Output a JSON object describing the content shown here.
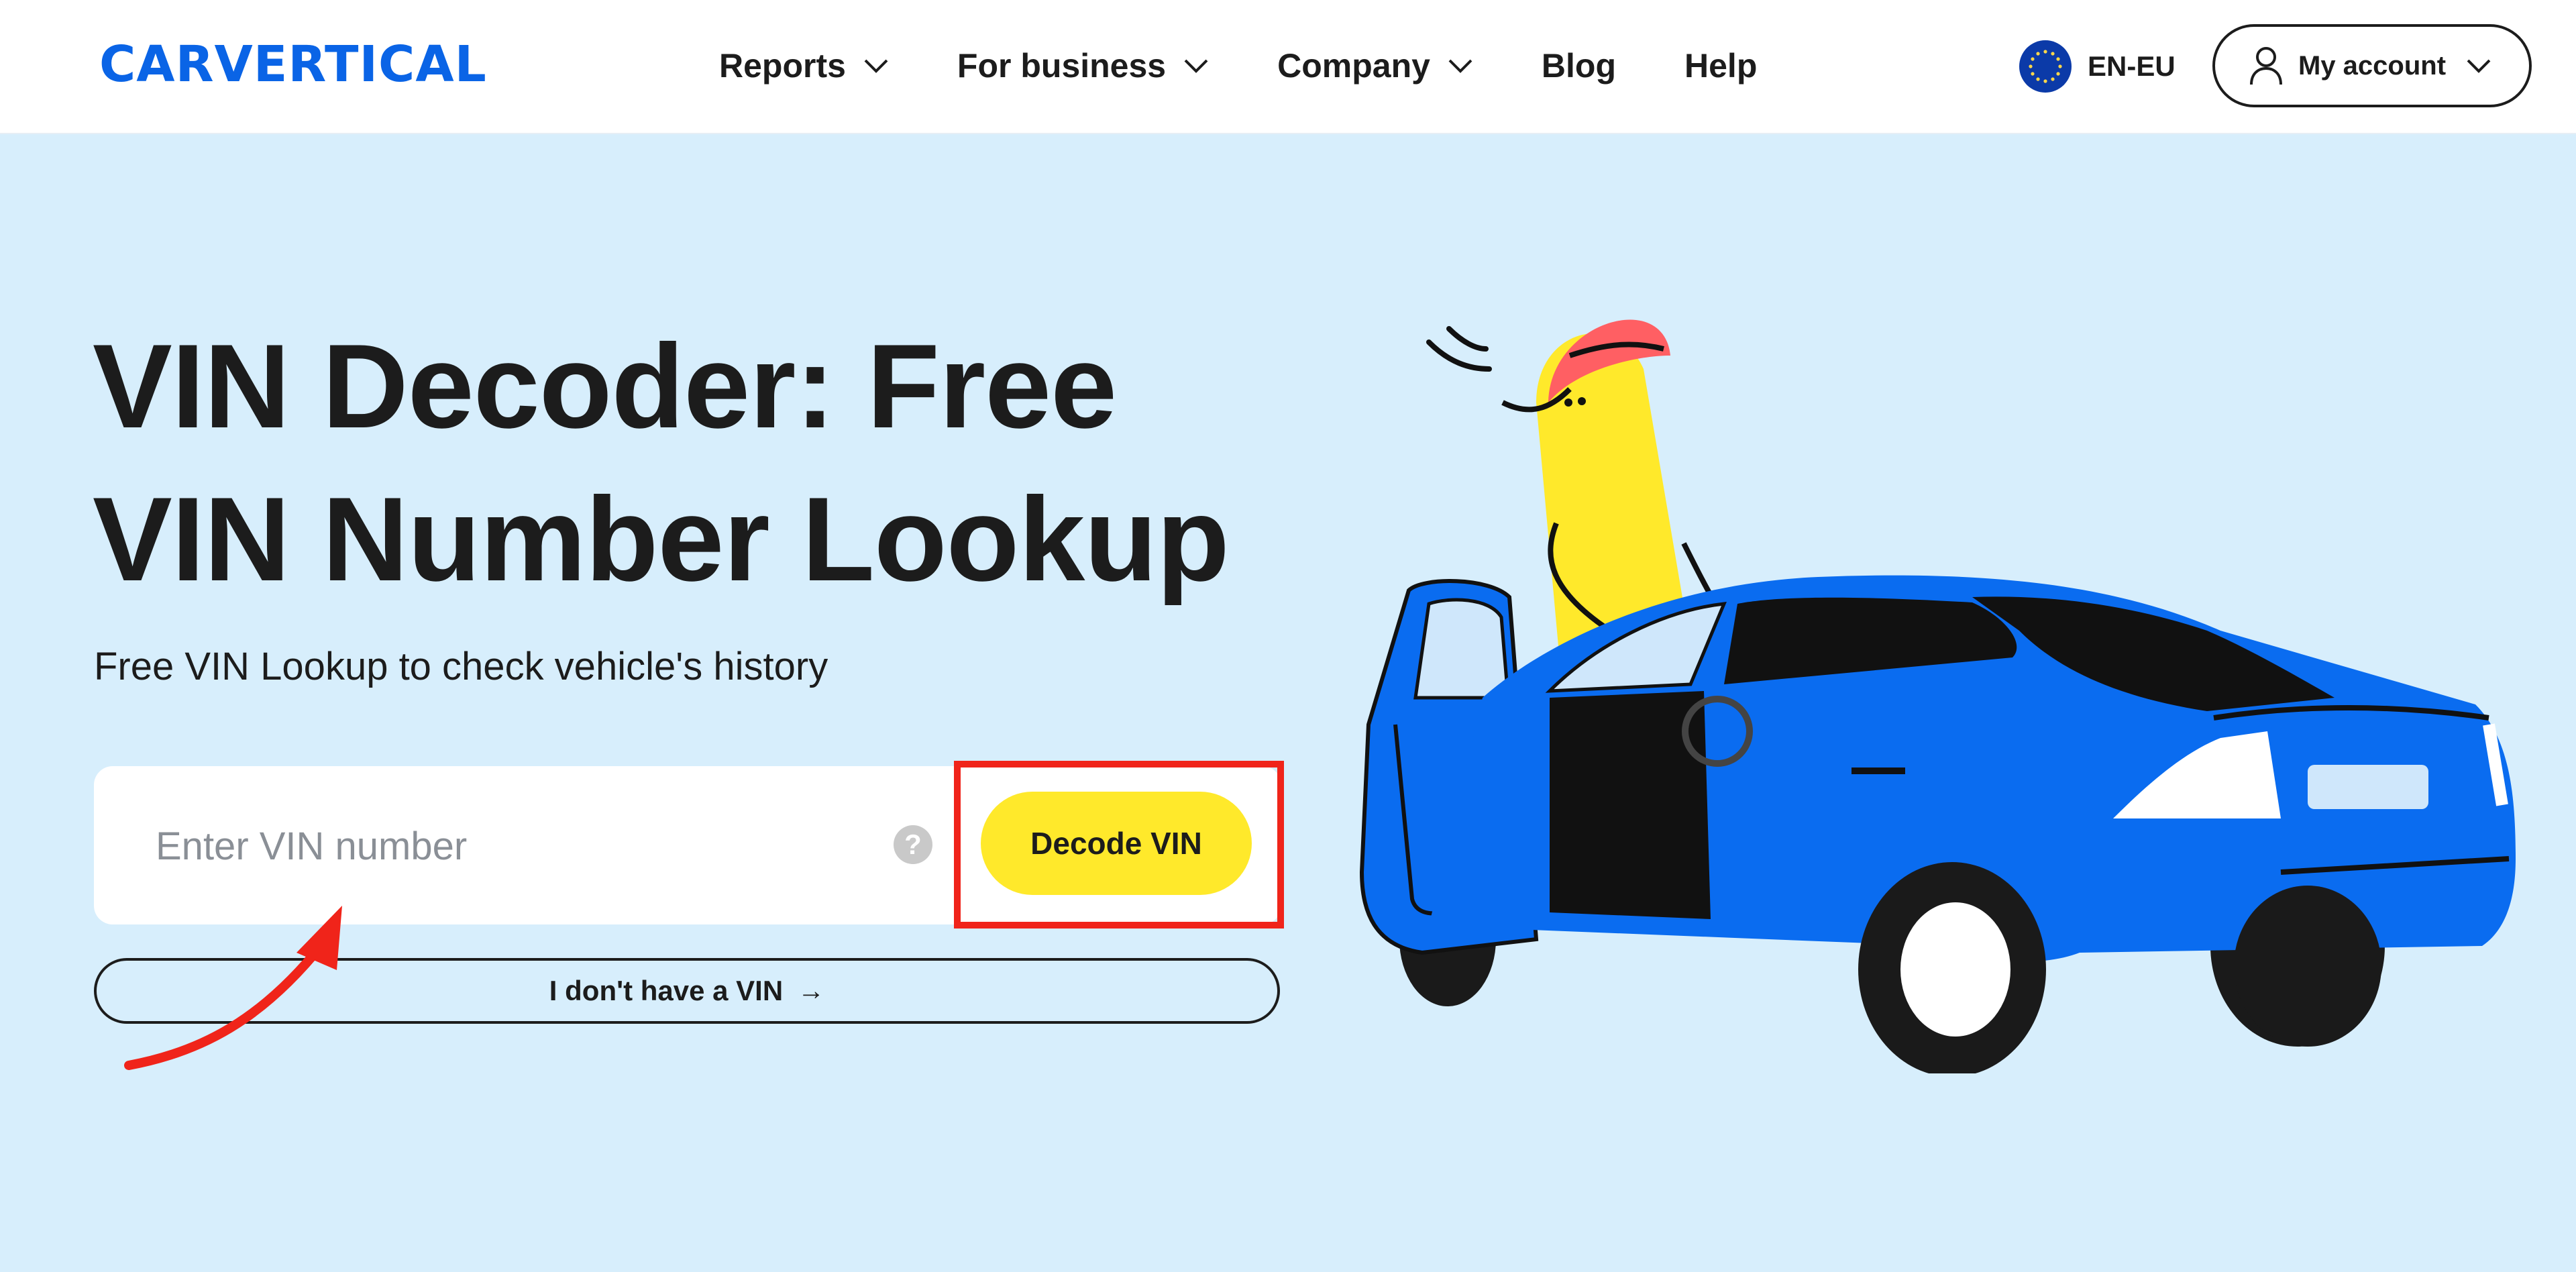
{
  "header": {
    "logo_text": "CARVERTICAL",
    "nav": [
      {
        "label": "Reports",
        "has_dropdown": true
      },
      {
        "label": "For business",
        "has_dropdown": true
      },
      {
        "label": "Company",
        "has_dropdown": true
      },
      {
        "label": "Blog",
        "has_dropdown": false
      },
      {
        "label": "Help",
        "has_dropdown": false
      }
    ],
    "language": "EN-EU",
    "account_label": "My account"
  },
  "hero": {
    "title_line1": "VIN Decoder: Free",
    "title_line2": "VIN Number Lookup",
    "subtitle": "Free VIN Lookup to check vehicle's history",
    "vin_placeholder": "Enter VIN number",
    "help_glyph": "?",
    "decode_button": "Decode VIN",
    "no_vin_button": "I don't have a VIN",
    "no_vin_arrow": "→"
  },
  "colors": {
    "brand_blue": "#0a64e6",
    "hero_background": "#d7eefc",
    "button_yellow": "#ffe92b",
    "annotation_red": "#f0241a",
    "car_blue": "#0a6cf0"
  },
  "icons": {
    "chevron": "chevron-down-icon",
    "flag": "eu-flag-icon",
    "user": "user-icon",
    "help": "help-icon",
    "arrow": "arrow-right-icon"
  }
}
